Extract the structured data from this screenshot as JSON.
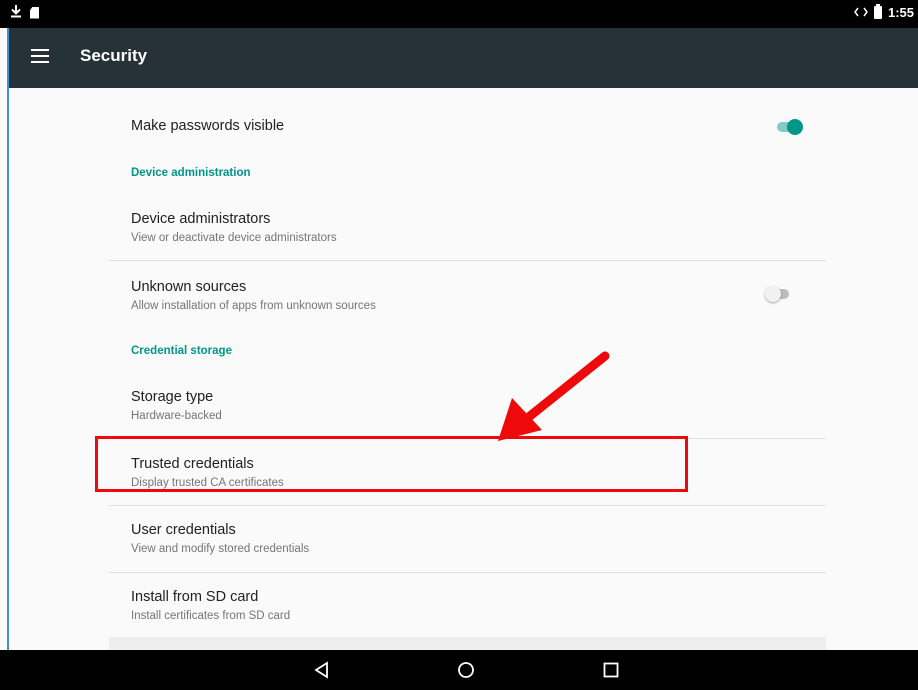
{
  "status_bar": {
    "time": "1:55",
    "icons": [
      "download-icon",
      "sd-card-icon",
      "sync-icon",
      "battery-icon"
    ]
  },
  "app_bar": {
    "title": "Security",
    "menu_icon": "hamburger-menu-icon"
  },
  "settings": {
    "make_passwords_visible": {
      "title": "Make passwords visible",
      "enabled": true
    },
    "section_device_admin": "Device administration",
    "device_administrators": {
      "title": "Device administrators",
      "summary": "View or deactivate device administrators"
    },
    "unknown_sources": {
      "title": "Unknown sources",
      "summary": "Allow installation of apps from unknown sources",
      "enabled": false
    },
    "section_credential_storage": "Credential storage",
    "storage_type": {
      "title": "Storage type",
      "summary": "Hardware-backed"
    },
    "trusted_credentials": {
      "title": "Trusted credentials",
      "summary": "Display trusted CA certificates"
    },
    "user_credentials": {
      "title": "User credentials",
      "summary": "View and modify stored credentials"
    },
    "install_from_sd": {
      "title": "Install from SD card",
      "summary": "Install certificates from SD card"
    }
  },
  "nav_bar": {
    "buttons": [
      "back-icon",
      "home-icon",
      "recents-icon"
    ]
  },
  "annotation": {
    "highlight_target": "Trusted credentials",
    "color": "#ee0a0a"
  },
  "colors": {
    "accent": "#009688",
    "app_bar": "#263238"
  }
}
